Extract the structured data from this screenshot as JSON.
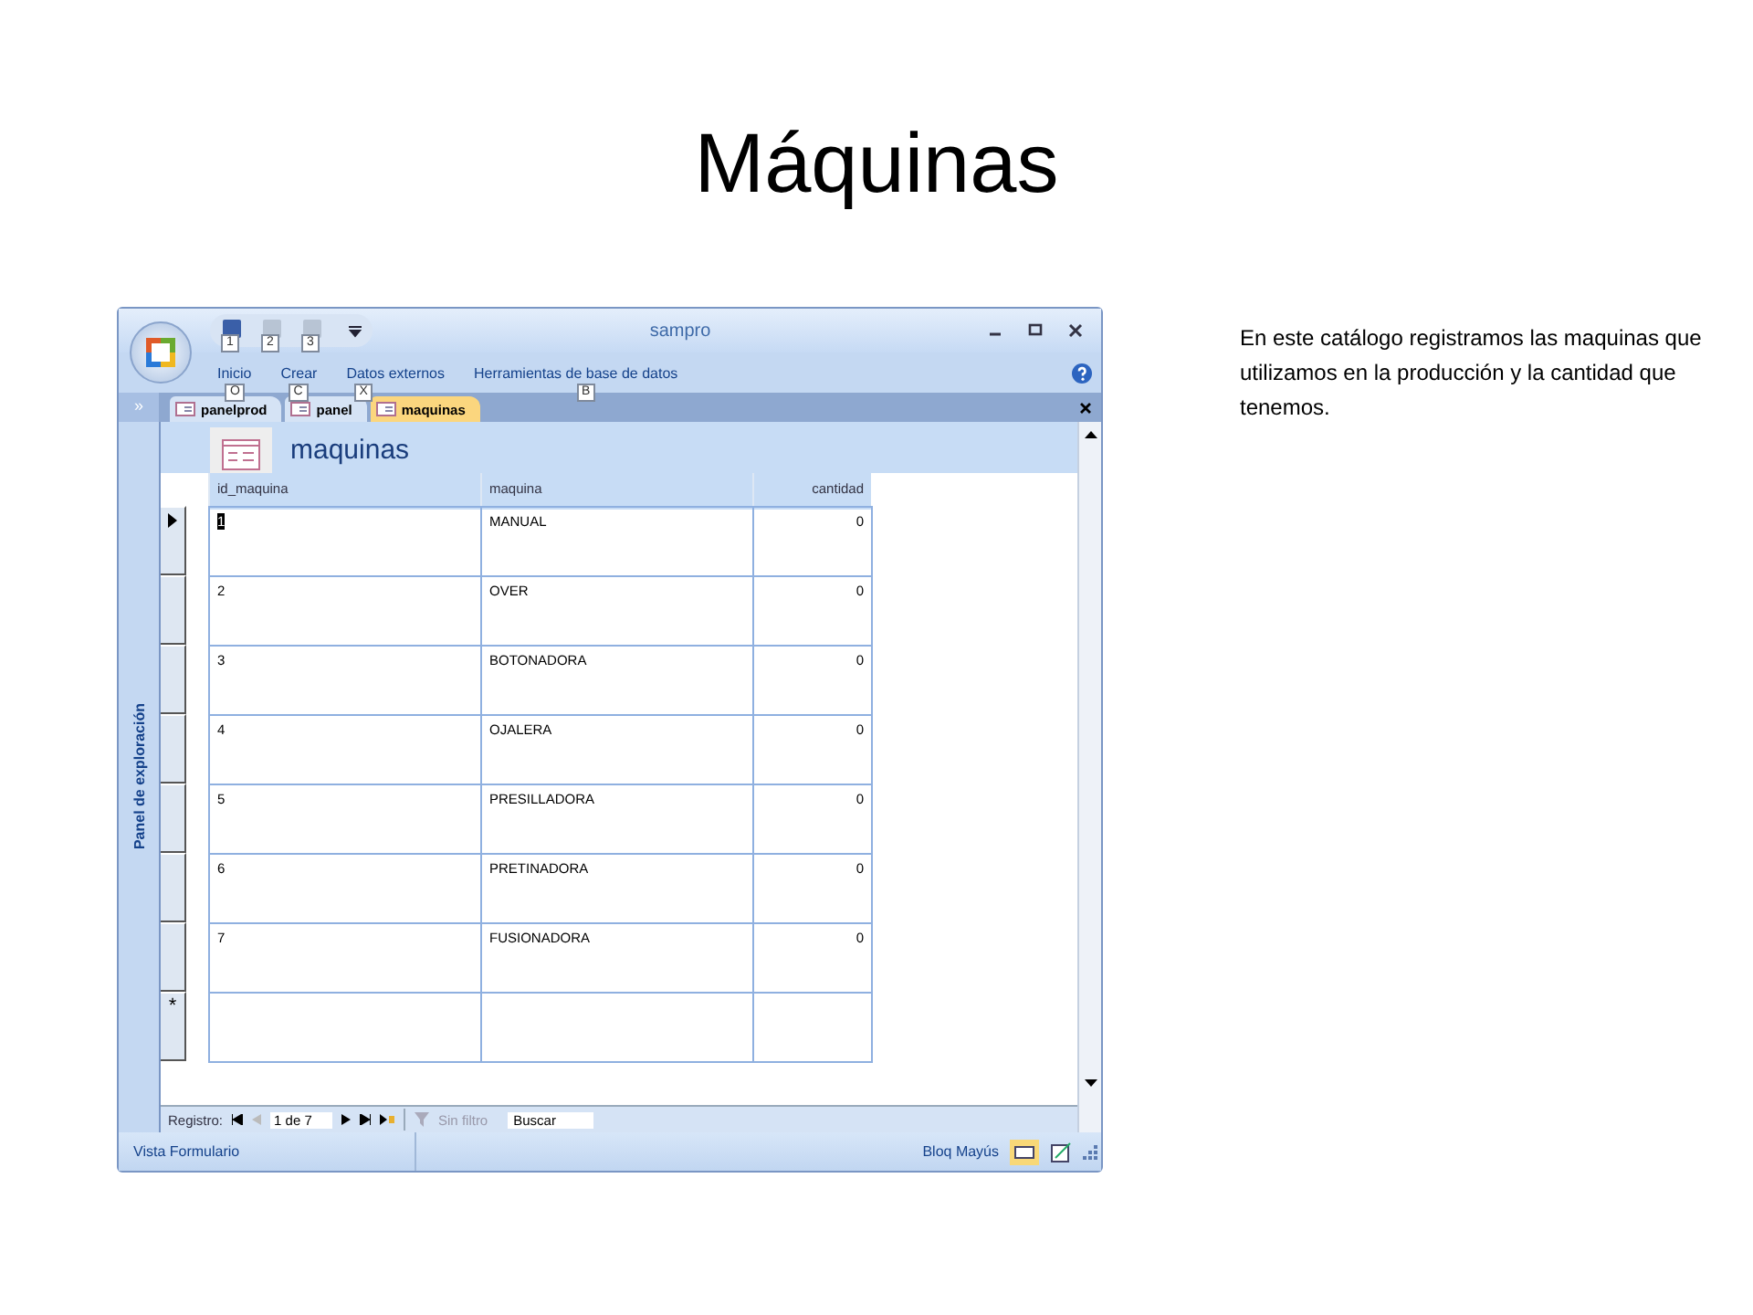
{
  "slide": {
    "title": "Máquinas",
    "description": "En este catálogo registramos las maquinas que utilizamos en la producción y la cantidad que tenemos."
  },
  "window": {
    "title": "sampro",
    "quick_access_keytips": [
      "1",
      "2",
      "3"
    ],
    "ribbon_tabs": [
      {
        "label": "Inicio",
        "keytip": "O"
      },
      {
        "label": "Crear",
        "keytip": "C"
      },
      {
        "label": "Datos externos",
        "keytip": "X"
      },
      {
        "label": "Herramientas de base de datos",
        "keytip": "B"
      }
    ],
    "nav_toggle": "»",
    "doc_tabs": [
      {
        "label": "panelprod",
        "selected": false
      },
      {
        "label": "panel",
        "selected": false
      },
      {
        "label": "maquinas",
        "selected": true
      }
    ],
    "nav_pane": "Panel de exploración",
    "form": {
      "title": "maquinas",
      "columns": [
        "id_maquina",
        "maquina",
        "cantidad"
      ],
      "rows": [
        {
          "cells": [
            "1",
            "MANUAL",
            "0"
          ],
          "current": true
        },
        {
          "cells": [
            "2",
            "OVER",
            "0"
          ],
          "current": false
        },
        {
          "cells": [
            "3",
            "BOTONADORA",
            "0"
          ],
          "current": false
        },
        {
          "cells": [
            "4",
            "OJALERA",
            "0"
          ],
          "current": false
        },
        {
          "cells": [
            "5",
            "PRESILLADORA",
            "0"
          ],
          "current": false
        },
        {
          "cells": [
            "6",
            "PRETINADORA",
            "0"
          ],
          "current": false
        },
        {
          "cells": [
            "7",
            "FUSIONADORA",
            "0"
          ],
          "current": false
        }
      ],
      "new_row_marker": "*"
    },
    "record_nav": {
      "label": "Registro:",
      "position": "1 de 7",
      "filter": "Sin filtro",
      "search": "Buscar"
    },
    "status_bar": {
      "view": "Vista Formulario",
      "caps": "Bloq Mayús"
    }
  }
}
